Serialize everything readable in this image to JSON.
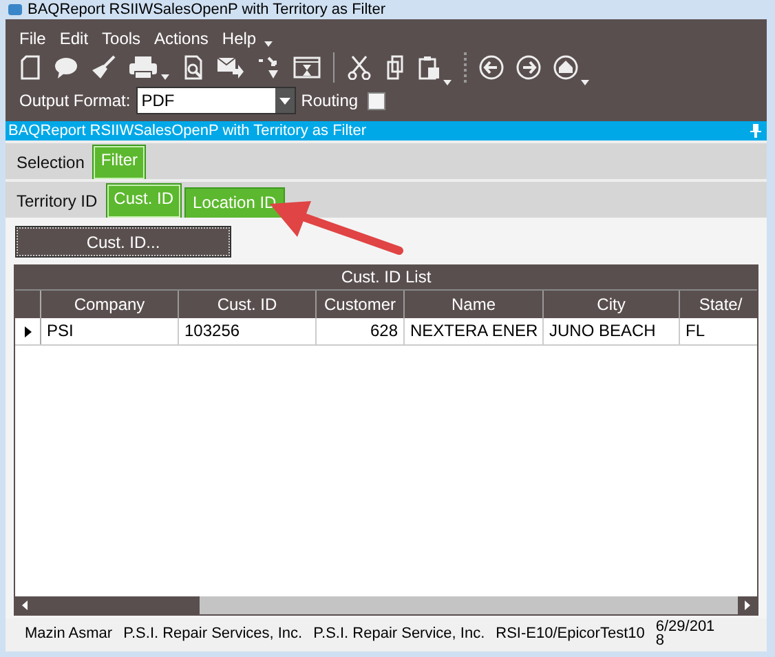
{
  "window": {
    "title": "BAQReport RSIIWSalesOpenP with Territory as Filter"
  },
  "menu": [
    "File",
    "Edit",
    "Tools",
    "Actions",
    "Help"
  ],
  "output_format": {
    "label": "Output Format:",
    "value": "PDF"
  },
  "routing": {
    "label": "Routing",
    "checked": false
  },
  "panel_title": "BAQReport RSIIWSalesOpenP with Territory as Filter",
  "tabs": [
    {
      "label": "Selection",
      "selected": false,
      "highlighted": false
    },
    {
      "label": "Filter",
      "selected": true,
      "highlighted": true
    }
  ],
  "subtabs": [
    {
      "label": "Territory ID",
      "selected": false,
      "highlighted": false
    },
    {
      "label": "Cust. ID",
      "selected": true,
      "highlighted": true
    },
    {
      "label": "Location ID",
      "selected": false,
      "highlighted": true
    }
  ],
  "lookup_button": "Cust. ID...",
  "grid": {
    "title": "Cust. ID List",
    "columns": [
      "Company",
      "Cust. ID",
      "Customer",
      "Name",
      "City",
      "State/"
    ],
    "rows": [
      [
        "PSI",
        "103256",
        "628",
        "NEXTERA ENER",
        "JUNO BEACH",
        "FL"
      ]
    ]
  },
  "status_bar": [
    "Mazin Asmar",
    "P.S.I. Repair Services, Inc.",
    "P.S.I. Repair Service, Inc.",
    "RSI-E10/EpicorTest10",
    "6/29/2018"
  ]
}
